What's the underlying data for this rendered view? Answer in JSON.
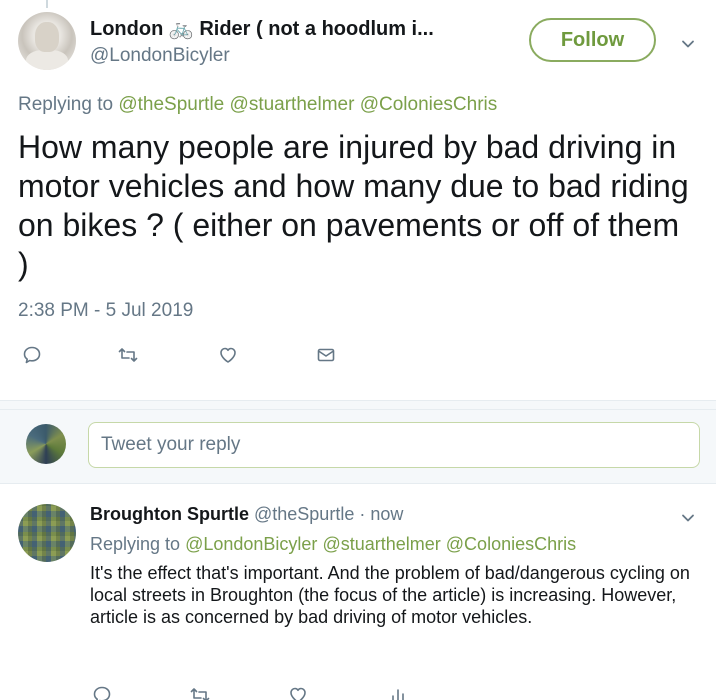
{
  "main_tweet": {
    "display_name": "London",
    "name_emoji": "🚲",
    "display_name_rest": "Rider ( not a hoodlum i...",
    "handle": "@LondonBicyler",
    "follow_label": "Follow",
    "replying_prefix": "Replying to",
    "replying_to": [
      "@theSpurtle",
      "@stuarthelmer",
      "@ColoniesChris"
    ],
    "text": "How many people are injured by bad driving in motor vehicles and how many due to bad riding on bikes ? ( either on pavements or off of them )",
    "timestamp": "2:38 PM - 5 Jul 2019"
  },
  "composer": {
    "placeholder": "Tweet your reply"
  },
  "reply_tweet": {
    "display_name": "Broughton Spurtle",
    "handle_time": "@theSpurtle · now",
    "replying_prefix": "Replying to",
    "replying_to": [
      "@LondonBicyler",
      "@stuarthelmer",
      "@ColoniesChris"
    ],
    "text": "It's the effect that's important. And the problem of bad/dangerous cycling on local streets in Broughton (the focus of the article) is increasing. However, article is as concerned by bad driving of motor vehicles."
  },
  "icons": {
    "reply": "speech-bubble-icon",
    "retweet": "retweet-icon",
    "like": "heart-icon",
    "dm": "envelope-icon",
    "analytics": "bar-chart-icon",
    "more": "chevron-down-icon"
  },
  "colors": {
    "accent": "#7ba04a",
    "follow_border": "#8aab5f",
    "muted": "#657786",
    "bike": "#e0245e"
  }
}
